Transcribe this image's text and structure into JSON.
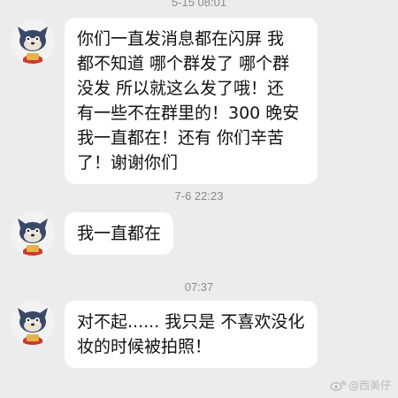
{
  "chat": {
    "messages": [
      {
        "timestamp": "5-15 08:01",
        "text": "你们一直发消息都在闪屏 我\n都不知道 哪个群发了 哪个群\n没发 所以就这么发了哦！还\n有一些不在群里的！300 晚安\n我一直都在！还有 你们辛苦\n了！谢谢你们"
      },
      {
        "timestamp": "7-6 22:23",
        "text": "我一直都在"
      },
      {
        "timestamp": "07:37",
        "text": "对不起...... 我只是 不喜欢没化\n妆的时候被拍照！"
      }
    ]
  },
  "watermark": {
    "text": "@西美仔"
  },
  "colors": {
    "background": "#ececec",
    "bubble": "#ffffff",
    "timestamp": "#8a8a8a",
    "text": "#111111"
  }
}
